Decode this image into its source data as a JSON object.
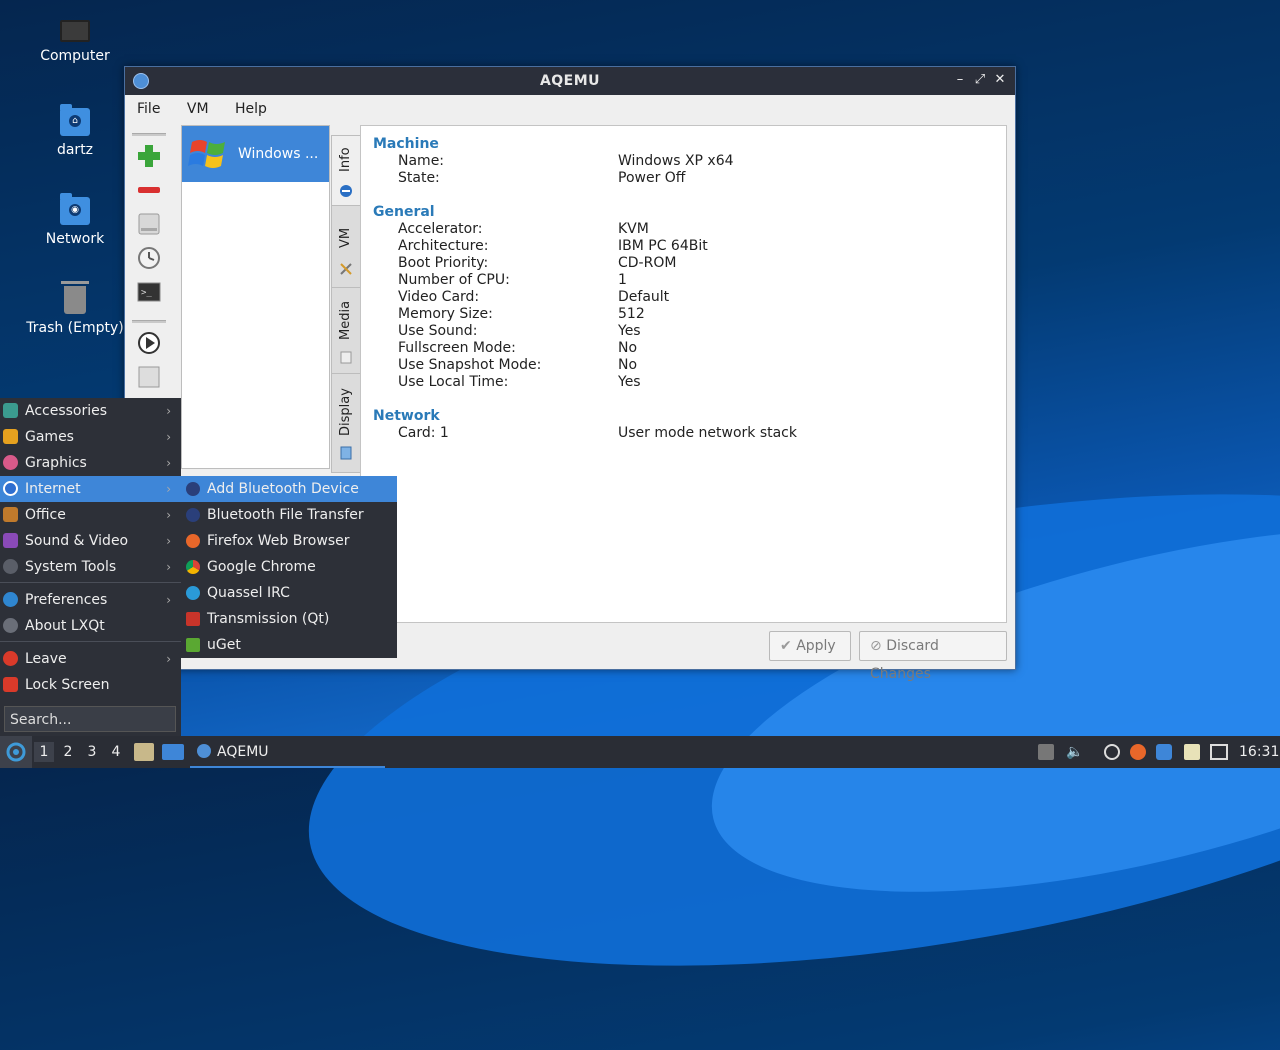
{
  "desktop": {
    "icons": [
      {
        "label": "Computer",
        "icon": "computer-icon"
      },
      {
        "label": "dartz",
        "icon": "home-folder-icon"
      },
      {
        "label": "Network",
        "icon": "network-folder-icon"
      },
      {
        "label": "Trash (Empty)",
        "icon": "trash-icon"
      }
    ]
  },
  "window": {
    "title": "AQEMU",
    "controls": {
      "minimize": "–",
      "maximize": "⤢",
      "close": "✕"
    },
    "menu": [
      "File",
      "VM",
      "Help"
    ],
    "vm_list": [
      {
        "name": "Windows ..."
      }
    ],
    "tabs": [
      "Info",
      "VM",
      "Media",
      "Display"
    ],
    "info": {
      "machine_title": "Machine",
      "machine": [
        {
          "label": "Name:",
          "value": "Windows XP x64"
        },
        {
          "label": "State:",
          "value": "Power Off"
        }
      ],
      "general_title": "General",
      "general": [
        {
          "label": "Accelerator:",
          "value": "KVM"
        },
        {
          "label": "Architecture:",
          "value": "IBM PC 64Bit"
        },
        {
          "label": "Boot Priority:",
          "value": "CD-ROM"
        },
        {
          "label": "Number of CPU:",
          "value": "1"
        },
        {
          "label": "Video Card:",
          "value": "Default"
        },
        {
          "label": "Memory Size:",
          "value": "512"
        },
        {
          "label": "Use Sound:",
          "value": "Yes"
        },
        {
          "label": "Fullscreen Mode:",
          "value": "No"
        },
        {
          "label": "Use Snapshot Mode:",
          "value": "No"
        },
        {
          "label": "Use Local Time:",
          "value": "Yes"
        }
      ],
      "network_title": "Network",
      "network": [
        {
          "label": "Card: 1",
          "value": "User mode network stack"
        }
      ]
    },
    "buttons": {
      "apply": "Apply",
      "discard": "Discard Changes"
    }
  },
  "start_menu": {
    "items": [
      {
        "label": "Accessories"
      },
      {
        "label": "Games"
      },
      {
        "label": "Graphics"
      },
      {
        "label": "Internet"
      },
      {
        "label": "Office"
      },
      {
        "label": "Sound & Video"
      },
      {
        "label": "System Tools"
      },
      {
        "label": "Preferences"
      },
      {
        "label": "About LXQt"
      },
      {
        "label": "Leave"
      },
      {
        "label": "Lock Screen"
      }
    ],
    "search_placeholder": "Search..."
  },
  "internet_submenu": [
    {
      "label": "Add Bluetooth Device"
    },
    {
      "label": "Bluetooth File Transfer"
    },
    {
      "label": "Firefox Web Browser"
    },
    {
      "label": "Google Chrome"
    },
    {
      "label": "Quassel IRC"
    },
    {
      "label": "Transmission (Qt)"
    },
    {
      "label": "uGet"
    }
  ],
  "taskbar": {
    "desktops": [
      "1",
      "2",
      "3",
      "4"
    ],
    "task_label": "AQEMU",
    "clock": "16:31"
  },
  "colors": {
    "accent": "#3e86d8",
    "section": "#2a7ab8"
  }
}
